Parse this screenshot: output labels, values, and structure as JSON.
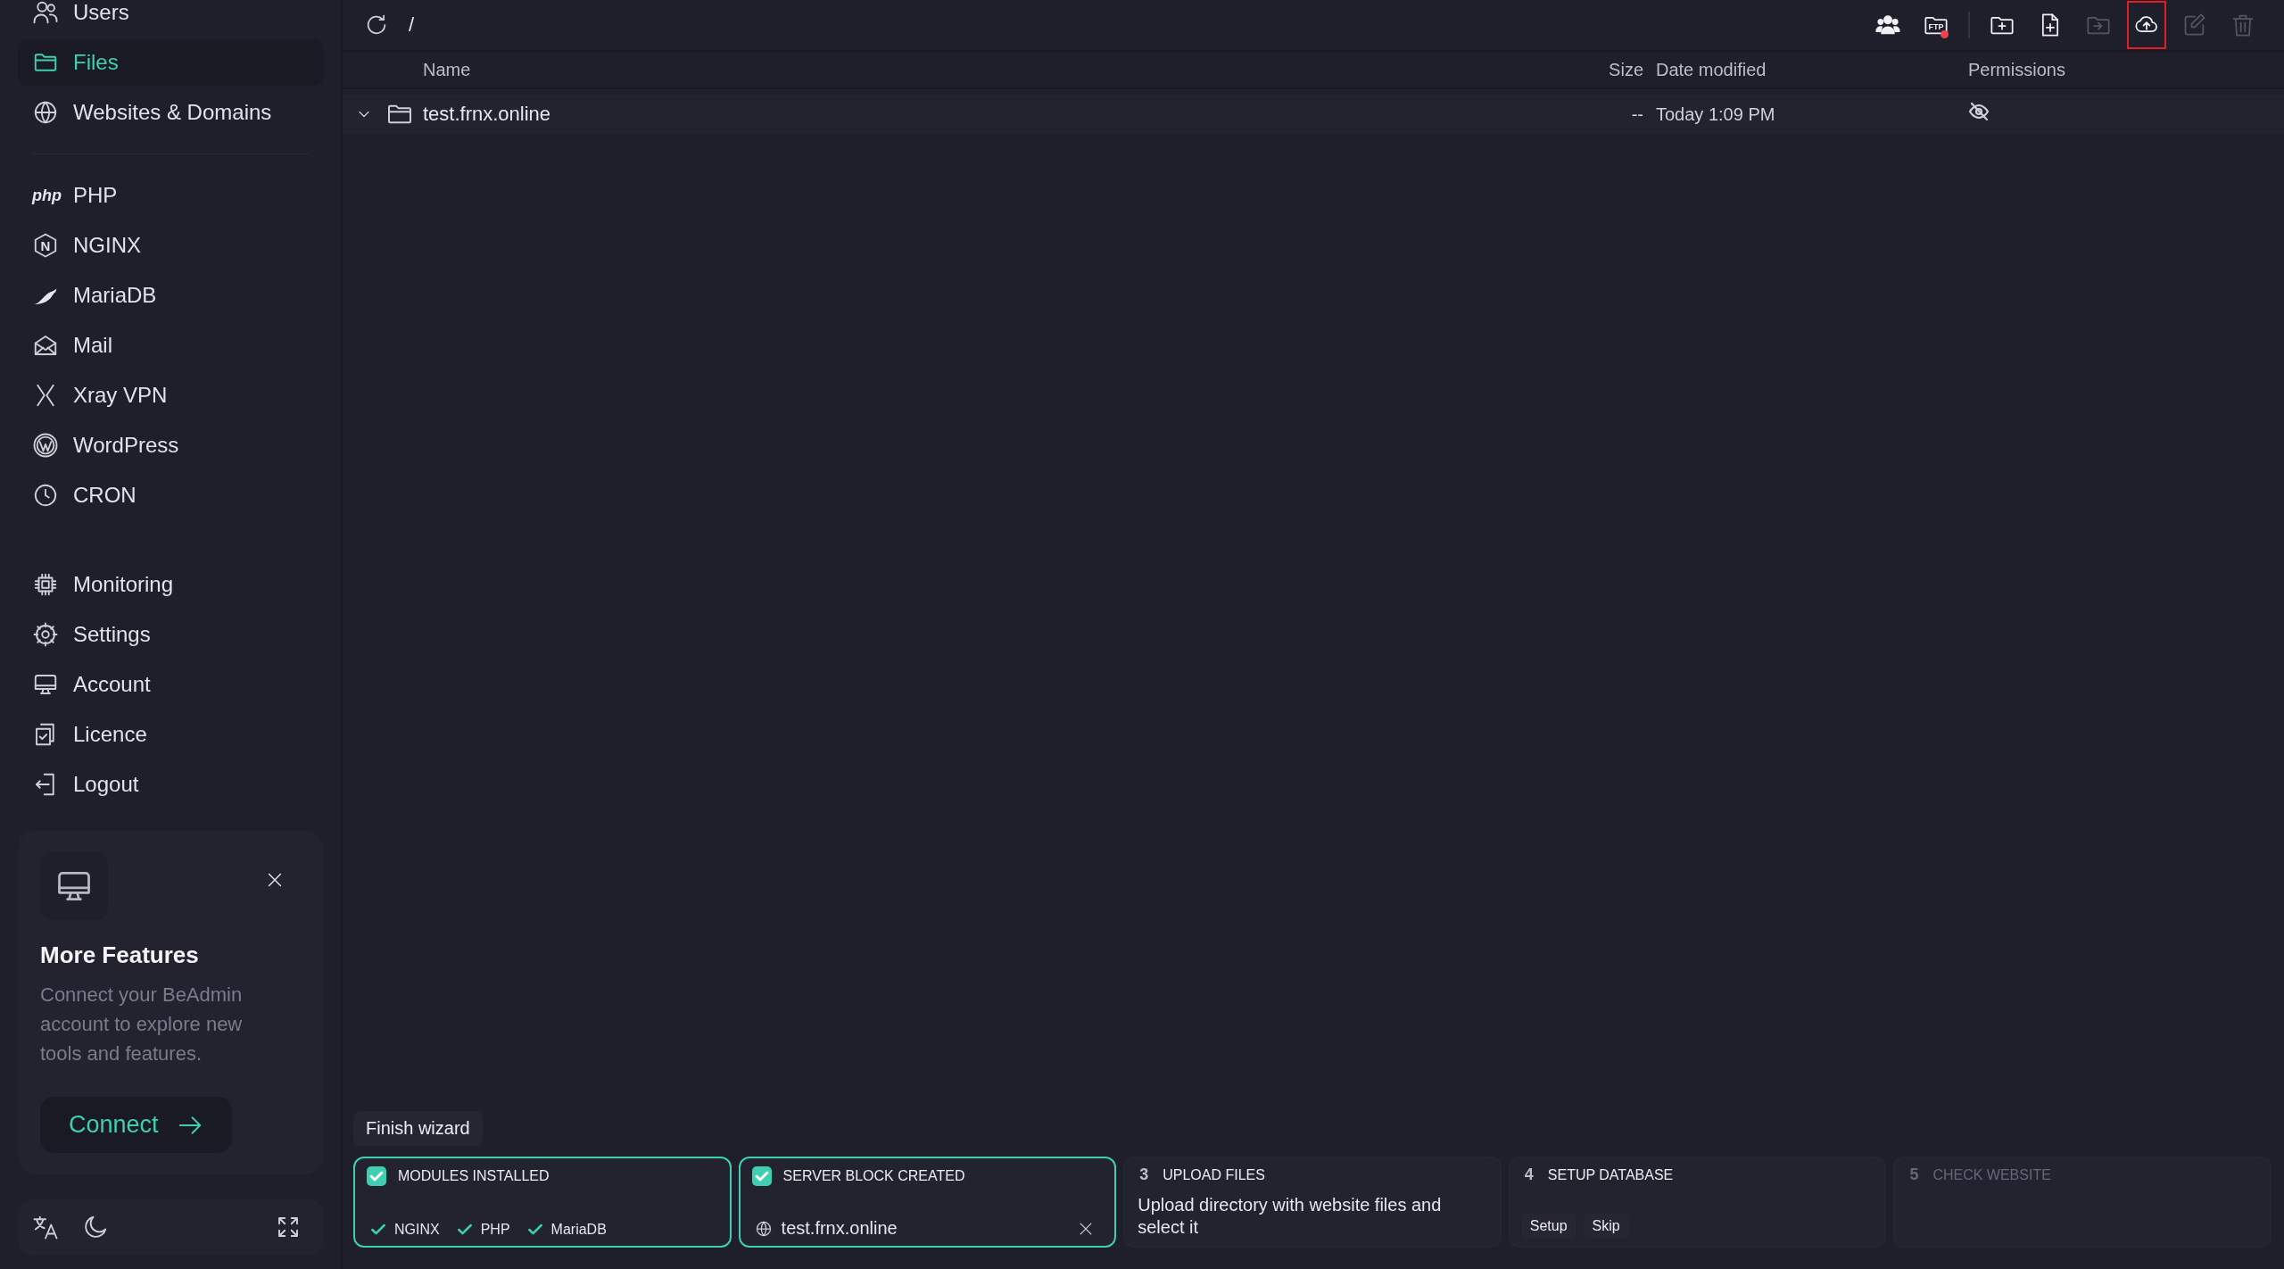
{
  "sidebar": {
    "groups": [
      {
        "divider_after": true,
        "items": [
          {
            "label": "Users",
            "selected": false
          },
          {
            "label": "Files",
            "selected": true
          },
          {
            "label": "Websites & Domains",
            "selected": false
          }
        ]
      },
      {
        "divider_after": false,
        "items": [
          {
            "label": "PHP",
            "logo_text": "php",
            "selected": false
          },
          {
            "label": "NGINX",
            "logo_text": "N",
            "selected": false
          },
          {
            "label": "MariaDB",
            "selected": false
          },
          {
            "label": "Mail",
            "selected": false
          },
          {
            "label": "Xray VPN",
            "selected": false
          },
          {
            "label": "WordPress",
            "selected": false
          },
          {
            "label": "CRON",
            "selected": false
          }
        ]
      },
      {
        "items": [
          {
            "label": "Monitoring",
            "selected": false
          },
          {
            "label": "Settings",
            "selected": false
          },
          {
            "label": "Account",
            "selected": false
          },
          {
            "label": "Licence",
            "selected": false
          },
          {
            "label": "Logout",
            "selected": false
          }
        ]
      }
    ]
  },
  "promo": {
    "title": "More Features",
    "text": "Connect your BeAdmin account to explore new tools and features.",
    "button": "Connect"
  },
  "toolbar": {
    "path": "/",
    "actions": [
      {
        "disabled": false,
        "highlighted": false
      },
      {
        "badge_text": "FTP",
        "notification": true,
        "separator_after": true,
        "disabled": false,
        "highlighted": false
      },
      {
        "disabled": false,
        "highlighted": false
      },
      {
        "disabled": false,
        "highlighted": false
      },
      {
        "disabled": true,
        "highlighted": false
      },
      {
        "disabled": false,
        "highlighted": true
      },
      {
        "disabled": true,
        "highlighted": false
      },
      {
        "disabled": true,
        "highlighted": false
      }
    ]
  },
  "table": {
    "columns": [
      "Name",
      "Size",
      "Date modified",
      "Permissions"
    ],
    "rows": [
      {
        "name": "test.frnx.online",
        "size": "--",
        "modified": "Today 1:09 PM"
      }
    ]
  },
  "wizard": {
    "finish_button": "Finish wizard",
    "steps": [
      {
        "kind": "modules",
        "title": "MODULES INSTALLED",
        "done": true,
        "disabled": false,
        "modules": [
          "NGINX",
          "PHP",
          "MariaDB"
        ]
      },
      {
        "kind": "domain",
        "title": "SERVER BLOCK CREATED",
        "done": true,
        "disabled": false,
        "domain": "test.frnx.online"
      },
      {
        "kind": "text",
        "number": "3",
        "title": "UPLOAD FILES",
        "done": false,
        "disabled": false,
        "text": "Upload directory with website files and select it"
      },
      {
        "kind": "actions",
        "number": "4",
        "title": "SETUP DATABASE",
        "done": false,
        "disabled": false,
        "actions": [
          "Setup",
          "Skip"
        ]
      },
      {
        "kind": "empty",
        "number": "5",
        "title": "CHECK WEBSITE",
        "done": false,
        "disabled": true
      }
    ]
  }
}
